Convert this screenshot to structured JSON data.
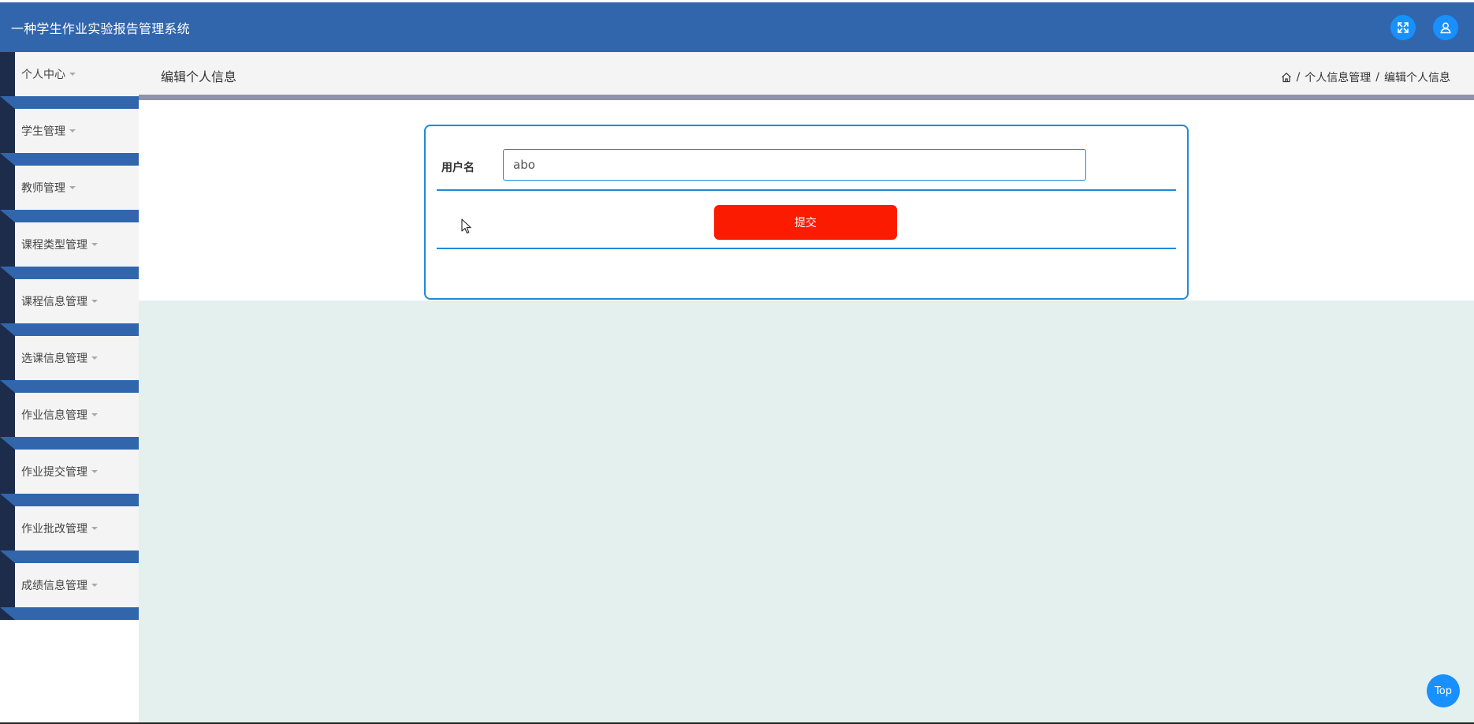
{
  "app": {
    "title": "一种学生作业实验报告管理系统"
  },
  "header": {
    "icons": [
      "fullscreen-icon",
      "user-icon"
    ],
    "accent": "#3166ad",
    "icon_bg": "#1890ff"
  },
  "sidebar": {
    "items": [
      {
        "label": "个人中心"
      },
      {
        "label": "学生管理"
      },
      {
        "label": "教师管理"
      },
      {
        "label": "课程类型管理"
      },
      {
        "label": "课程信息管理"
      },
      {
        "label": "选课信息管理"
      },
      {
        "label": "作业信息管理"
      },
      {
        "label": "作业提交管理"
      },
      {
        "label": "作业批改管理"
      },
      {
        "label": "成绩信息管理"
      }
    ]
  },
  "page": {
    "title": "编辑个人信息",
    "breadcrumb": {
      "home_icon": "home-icon",
      "items": [
        "个人信息管理",
        "编辑个人信息"
      ],
      "separator": "/"
    }
  },
  "form": {
    "username_label": "用户名",
    "username_value": "abo",
    "submit_label": "提交",
    "submit_color": "#fb1b00"
  },
  "back_to_top": {
    "label": "Top"
  }
}
